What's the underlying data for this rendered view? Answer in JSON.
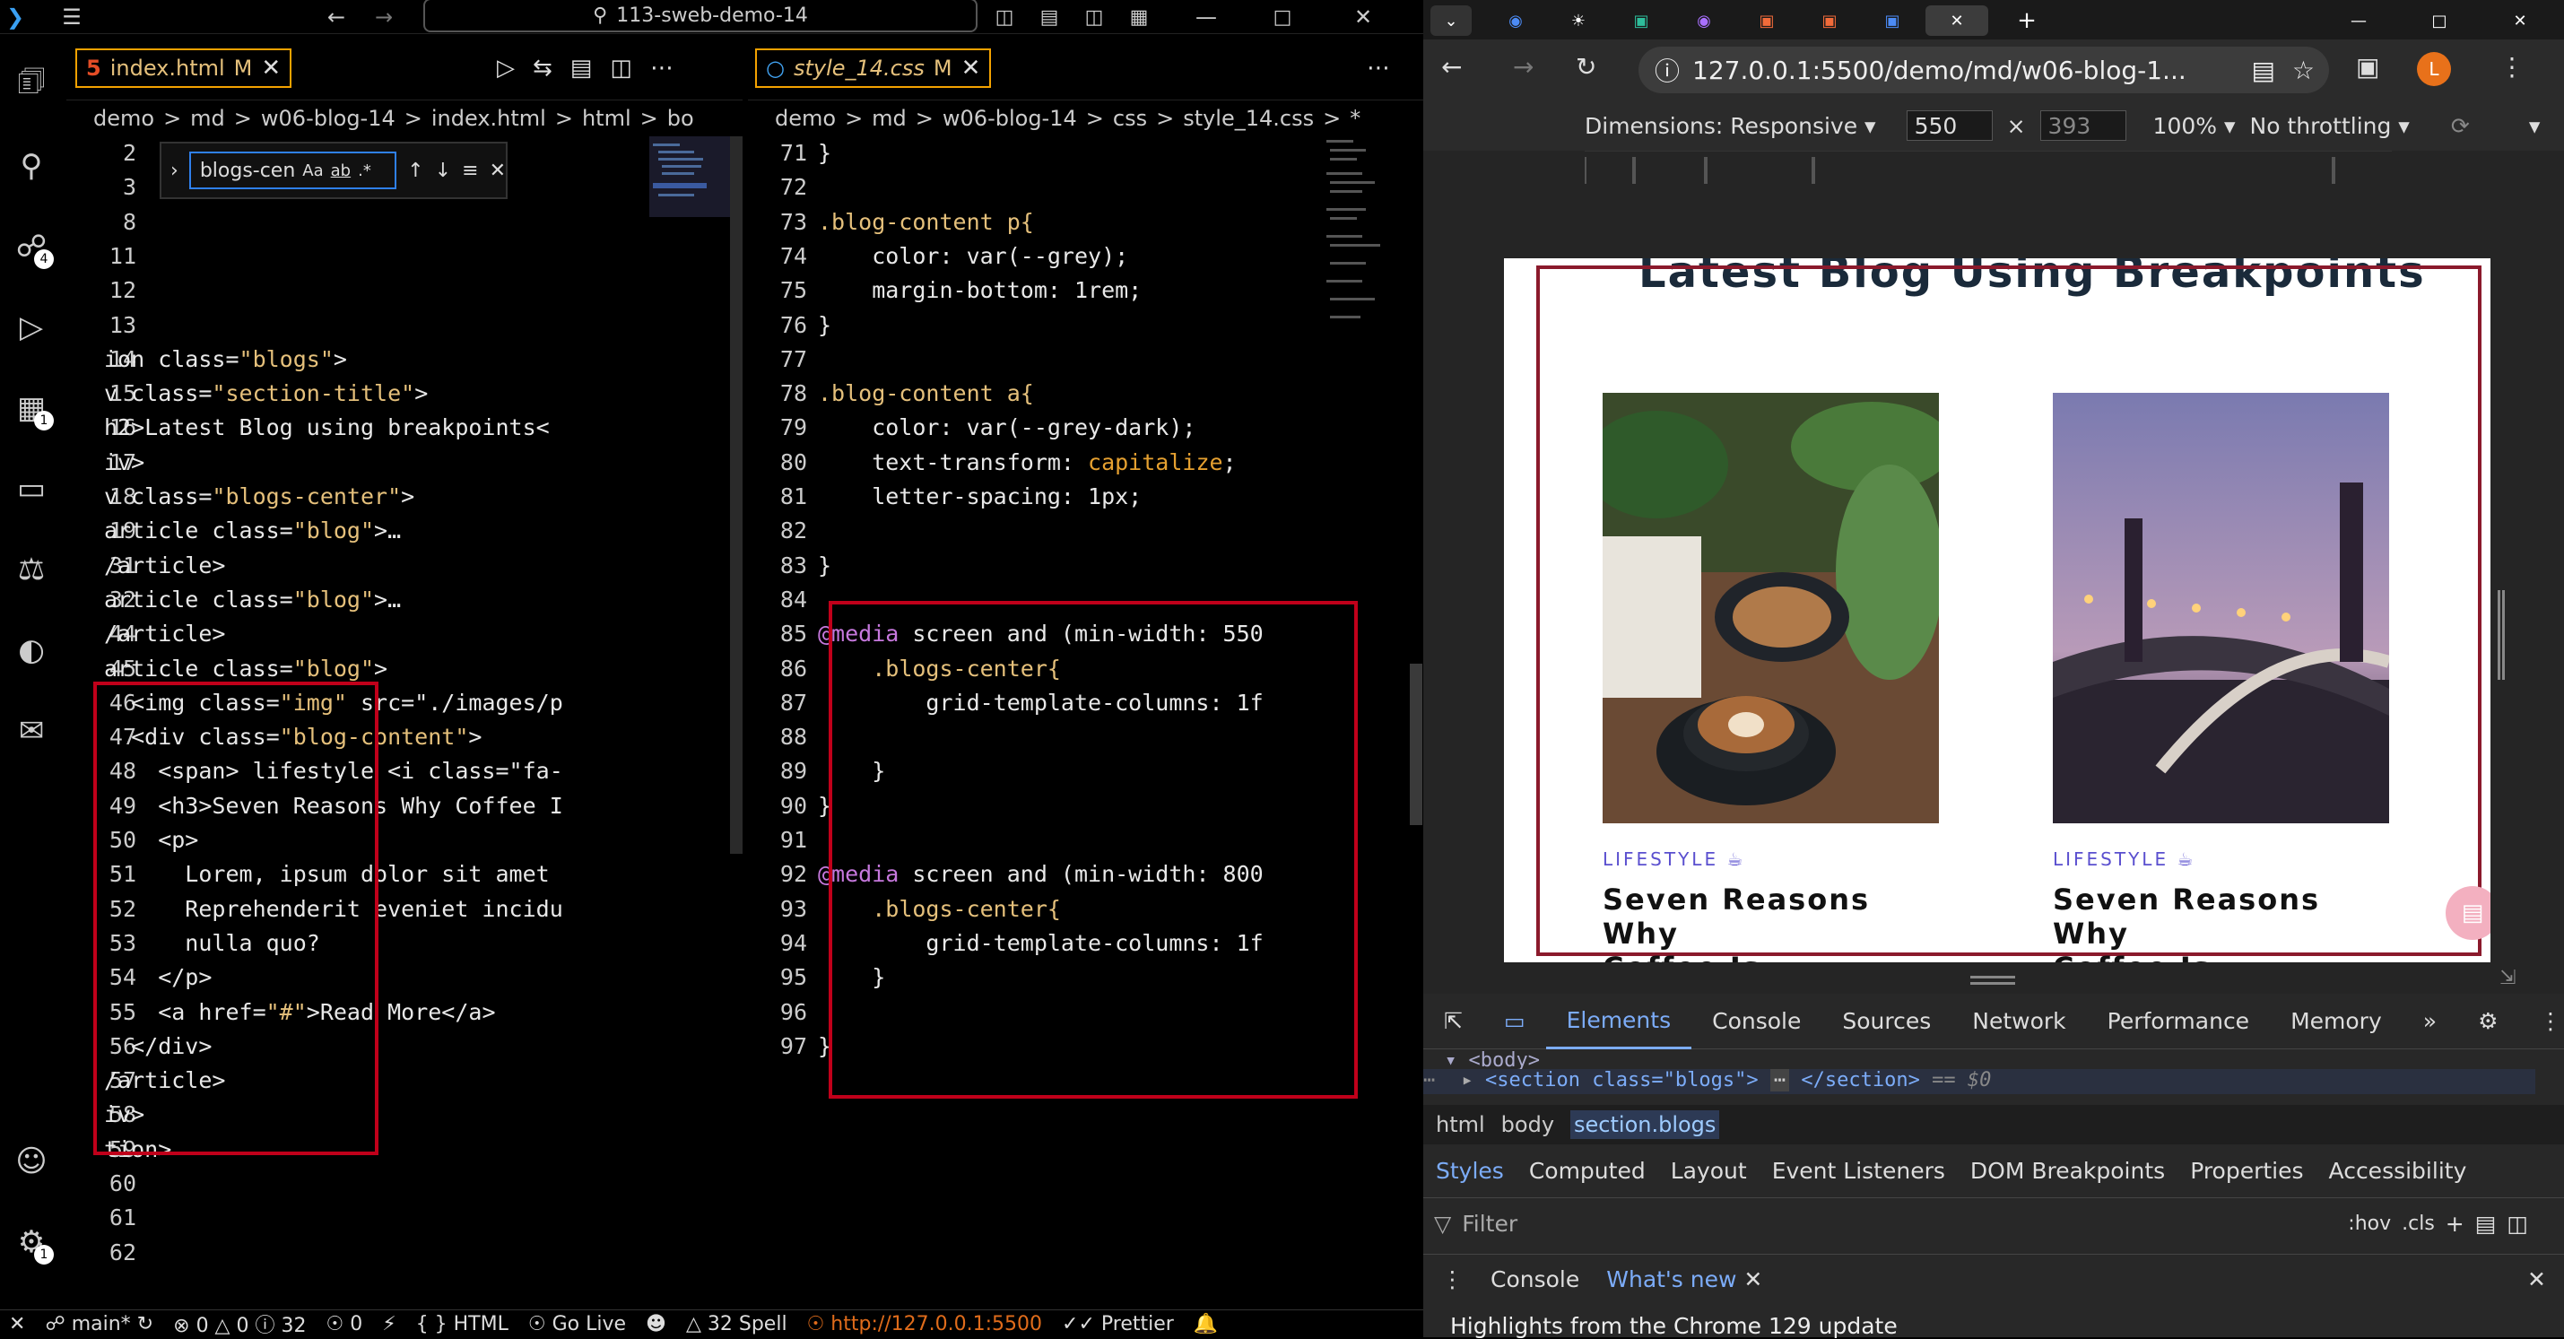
{
  "vscode": {
    "search_text": "113-sweb-demo-14",
    "left_tab": {
      "name": "index.html",
      "modified": "M"
    },
    "right_tab": {
      "name": "style_14.css",
      "modified": "M"
    },
    "left_crumbs": [
      "demo",
      ">",
      "md",
      ">",
      "w06-blog-14",
      ">",
      "index.html",
      ">",
      "html",
      ">",
      "bo"
    ],
    "right_crumbs": [
      "demo",
      ">",
      "md",
      ">",
      "w06-blog-14",
      ">",
      "css",
      ">",
      "style_14.css",
      ">",
      "*"
    ],
    "find": {
      "query": "blogs-cen",
      "case": "Aa",
      "word": "ab",
      "regex": ".*"
    },
    "left_lines": [
      {
        "n": "2",
        "t": ""
      },
      {
        "n": "3",
        "t": ""
      },
      {
        "n": "8",
        "t": ""
      },
      {
        "n": "11",
        "t": ""
      },
      {
        "n": "12",
        "t": ""
      },
      {
        "n": "13",
        "t": ""
      },
      {
        "n": "14",
        "t": "ion class=\"blogs\">"
      },
      {
        "n": "15",
        "t": "v class=\"section-title\">"
      },
      {
        "n": "16",
        "t": "h2>Latest Blog using breakpoints<"
      },
      {
        "n": "17",
        "t": "iv>"
      },
      {
        "n": "18",
        "t": "v class=\"blogs-center\">"
      },
      {
        "n": "19",
        "t": "article class=\"blog\">…"
      },
      {
        "n": "31",
        "t": "/article>"
      },
      {
        "n": "32",
        "t": "article class=\"blog\">…"
      },
      {
        "n": "44",
        "t": "/article>"
      },
      {
        "n": "45",
        "t": "article class=\"blog\">"
      },
      {
        "n": "46",
        "t": "  <img class=\"img\" src=\"./images/p"
      },
      {
        "n": "47",
        "t": "  <div class=\"blog-content\">"
      },
      {
        "n": "48",
        "t": "    <span> lifestyle <i class=\"fa-"
      },
      {
        "n": "49",
        "t": "    <h3>Seven Reasons Why Coffee I"
      },
      {
        "n": "50",
        "t": "    <p>"
      },
      {
        "n": "51",
        "t": "      Lorem, ipsum dolor sit amet"
      },
      {
        "n": "52",
        "t": "      Reprehenderit eveniet incidu"
      },
      {
        "n": "53",
        "t": "      nulla quo?"
      },
      {
        "n": "54",
        "t": "    </p>"
      },
      {
        "n": "55",
        "t": "    <a href=\"#\">Read More</a>"
      },
      {
        "n": "56",
        "t": "  </div>"
      },
      {
        "n": "57",
        "t": "/article>"
      },
      {
        "n": "58",
        "t": "iv>"
      },
      {
        "n": "59",
        "t": "tion>"
      },
      {
        "n": "60",
        "t": ""
      },
      {
        "n": "61",
        "t": ""
      },
      {
        "n": "62",
        "t": ""
      }
    ],
    "right_lines": [
      {
        "n": "71",
        "t": "}"
      },
      {
        "n": "72",
        "t": ""
      },
      {
        "n": "73",
        "t": ".blog-content p{"
      },
      {
        "n": "74",
        "t": "    color: var(--grey);"
      },
      {
        "n": "75",
        "t": "    margin-bottom: 1rem;"
      },
      {
        "n": "76",
        "t": "}"
      },
      {
        "n": "77",
        "t": ""
      },
      {
        "n": "78",
        "t": ".blog-content a{"
      },
      {
        "n": "79",
        "t": "    color: var(--grey-dark);"
      },
      {
        "n": "80",
        "t": "    text-transform: capitalize;"
      },
      {
        "n": "81",
        "t": "    letter-spacing: 1px;"
      },
      {
        "n": "82",
        "t": ""
      },
      {
        "n": "83",
        "t": "}"
      },
      {
        "n": "84",
        "t": ""
      },
      {
        "n": "85",
        "t": "@media screen and (min-width: 550"
      },
      {
        "n": "86",
        "t": "    .blogs-center{"
      },
      {
        "n": "87",
        "t": "        grid-template-columns: 1f"
      },
      {
        "n": "88",
        "t": ""
      },
      {
        "n": "89",
        "t": "    }"
      },
      {
        "n": "90",
        "t": "}"
      },
      {
        "n": "91",
        "t": ""
      },
      {
        "n": "92",
        "t": "@media screen and (min-width: 800"
      },
      {
        "n": "93",
        "t": "    .blogs-center{"
      },
      {
        "n": "94",
        "t": "        grid-template-columns: 1f"
      },
      {
        "n": "95",
        "t": "    }"
      },
      {
        "n": "96",
        "t": ""
      },
      {
        "n": "97",
        "t": "}"
      }
    ],
    "status": {
      "branch": "main*",
      "errors": "0",
      "warnings": "0",
      "info": "32",
      "ports": "0",
      "language": "HTML",
      "golive": "Go Live",
      "spell": "32 Spell",
      "server": "http://127.0.0.1:5500",
      "prettier": "Prettier"
    }
  },
  "browser": {
    "url": "127.0.0.1:5500/demo/md/w06-blog-1...",
    "profile_letter": "L",
    "dimensions_label": "Dimensions: Responsive",
    "width": "550",
    "height": "393",
    "zoom": "100%",
    "throttle": "No throttling",
    "page_title": "Latest Blog Using Breakpoints",
    "cards": [
      {
        "category": "LIFESTYLE",
        "title_line1": "Seven Reasons Why",
        "title_line2": "Coffee Is Awesome"
      },
      {
        "category": "LIFESTYLE",
        "title_line1": "Seven Reasons Why",
        "title_line2": "Coffee Is Awesome"
      }
    ],
    "devtools": {
      "tabs": [
        "Elements",
        "Console",
        "Sources",
        "Network",
        "Performance",
        "Memory"
      ],
      "active_tab": "Elements",
      "dom_body": "<body>",
      "dom_section_open": "<section class=\"blogs\">",
      "dom_section_close": "</section>",
      "dom_eq": "== $0",
      "breadcrumbs": [
        "html",
        "body",
        "section.blogs"
      ],
      "style_tabs": [
        "Styles",
        "Computed",
        "Layout",
        "Event Listeners",
        "DOM Breakpoints",
        "Properties",
        "Accessibility"
      ],
      "filter_placeholder": "Filter",
      "hov": ":hov",
      "cls": ".cls",
      "drawer_tabs": [
        "Console",
        "What's new"
      ],
      "highlights": "Highlights from the Chrome 129 update"
    }
  }
}
